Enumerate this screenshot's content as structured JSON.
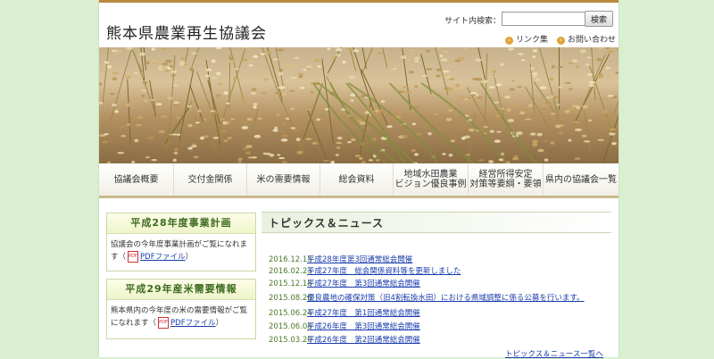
{
  "header": {
    "site_title": "熊本県農業再生協議会",
    "search_label": "サイト内検索：",
    "search_value": "",
    "search_button": "検索",
    "links": [
      {
        "label": "リンク集"
      },
      {
        "label": "お問い合わせ"
      }
    ]
  },
  "nav": {
    "items": [
      {
        "label": "協議会概要"
      },
      {
        "label": "交付金関係"
      },
      {
        "label": "米の需要情報"
      },
      {
        "label": "総会資料"
      },
      {
        "label": "地域水田農業\nビジョン優良事例"
      },
      {
        "label": "経営所得安定\n対策等要綱・要領"
      },
      {
        "label": "県内の協議会一覧"
      }
    ]
  },
  "sidebar": {
    "plan": {
      "heading": "平成28年度事業計画",
      "text": "協議会の今年度事業計画がご覧になれます",
      "pdf_icon": "PDF",
      "link": "PDFファイル"
    },
    "demand": {
      "heading": "平成29年産米需要情報",
      "text": "熊本県内の今年度の米の需要情報がご覧になれます",
      "pdf_icon": "PDF",
      "link": "PDFファイル"
    }
  },
  "topics": {
    "title": "トピックス＆ニュース",
    "items": [
      {
        "date": "2016.12.15",
        "title": "平成28年度第3回通常総会開催"
      },
      {
        "date": "2016.02.23",
        "title": "平成27年度　総会関係資料等を更新しました"
      },
      {
        "date": "2015.12.18",
        "title": "平成27年度　第3回通常総会開催"
      },
      {
        "date": "2015.08.26",
        "title": "優良農地の確保対策（旧4割転換水田）における県域調整に係る公募を行います。"
      },
      {
        "date": "2015.06.24",
        "title": "平成27年度　第1回通常総会開催"
      },
      {
        "date": "2015.06.08",
        "title": "平成26年度　第3回通常総会開催"
      },
      {
        "date": "2015.03.20",
        "title": "平成26年度　第2回通常総会開催"
      }
    ],
    "more": "トピックス＆ニュース一覧へ"
  },
  "colors": {
    "background": "#d9efd0",
    "accent_gold": "#b98a3e",
    "panel_heading": "#3c6a1f",
    "link": "#1a3cad",
    "date": "#4d7a2a"
  }
}
